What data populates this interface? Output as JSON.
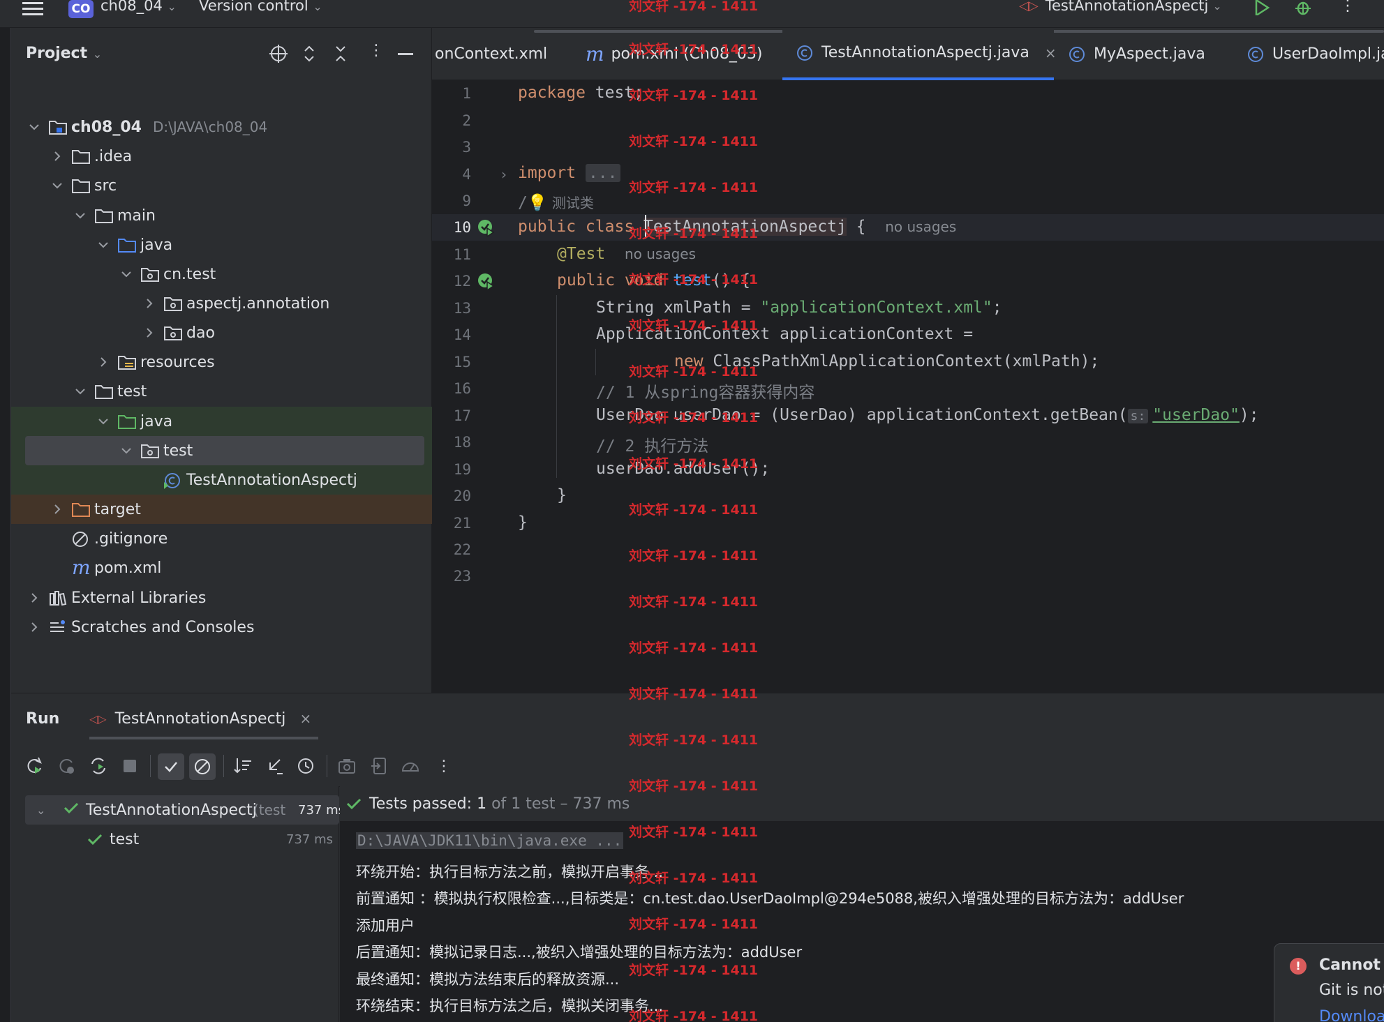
{
  "topbar": {
    "project_badge": "CO",
    "project_name": "ch08_04",
    "vcs_label": "Version control",
    "run_config": "TestAnnotationAspectj"
  },
  "project_panel": {
    "title": "Project",
    "tree": [
      {
        "label": "ch08_04",
        "path": "D:\\JAVA\\ch08_04",
        "depth": 0,
        "icon": "module-folder-icon",
        "expanded": true
      },
      {
        "label": ".idea",
        "depth": 1,
        "icon": "folder-icon",
        "expanded": false
      },
      {
        "label": "src",
        "depth": 1,
        "icon": "folder-icon",
        "expanded": true
      },
      {
        "label": "main",
        "depth": 2,
        "icon": "folder-icon",
        "expanded": true
      },
      {
        "label": "java",
        "depth": 3,
        "icon": "source-folder-icon",
        "expanded": true
      },
      {
        "label": "cn.test",
        "depth": 4,
        "icon": "package-icon",
        "expanded": true
      },
      {
        "label": "aspectj.annotation",
        "depth": 5,
        "icon": "package-icon",
        "expanded": false
      },
      {
        "label": "dao",
        "depth": 5,
        "icon": "package-icon",
        "expanded": false
      },
      {
        "label": "resources",
        "depth": 3,
        "icon": "resources-folder-icon",
        "expanded": false
      },
      {
        "label": "test",
        "depth": 2,
        "icon": "folder-icon",
        "expanded": true
      },
      {
        "label": "java",
        "depth": 3,
        "icon": "test-folder-icon",
        "expanded": true
      },
      {
        "label": "test",
        "depth": 4,
        "icon": "package-icon",
        "expanded": true
      },
      {
        "label": "TestAnnotationAspectj",
        "depth": 5,
        "icon": "class-icon"
      },
      {
        "label": "target",
        "depth": 1,
        "icon": "excluded-folder-icon",
        "expanded": false
      },
      {
        "label": ".gitignore",
        "depth": 1,
        "icon": "ignore-file-icon"
      },
      {
        "label": "pom.xml",
        "depth": 1,
        "icon": "maven-icon"
      },
      {
        "label": "External Libraries",
        "depth": 0,
        "icon": "libraries-icon",
        "expanded": false
      },
      {
        "label": "Scratches and Consoles",
        "depth": 0,
        "icon": "scratches-icon",
        "expanded": false
      }
    ]
  },
  "editor": {
    "tabs": [
      {
        "label": "onContext.xml",
        "icon": ""
      },
      {
        "label": "pom.xml (Ch08_03)",
        "icon": "maven-icon"
      },
      {
        "label": "TestAnnotationAspectj.java",
        "icon": "class-icon",
        "active": true
      },
      {
        "label": "MyAspect.java",
        "icon": "class-icon"
      },
      {
        "label": "UserDaoImpl.jav",
        "icon": "class-icon"
      }
    ],
    "line_numbers": [
      "1",
      "2",
      "3",
      "4",
      "9",
      "10",
      "11",
      "12",
      "13",
      "14",
      "15",
      "16",
      "17",
      "18",
      "19",
      "20",
      "21",
      "22",
      "23"
    ],
    "code": {
      "l1_kw": "package",
      "l1_rest": " test;",
      "l4_kw": "import",
      "l4_fold": "...",
      "l9_cmt": "/",
      "l9_cmt2": " 测试类",
      "l10_kw": "public class ",
      "l10_name": "TestAnnotationAspectj",
      "l10_rest": " {",
      "l10_hint": "no usages",
      "l11_ann": "@Test",
      "l11_hint": "no usages",
      "l12_kw": "public void ",
      "l12_fn": "test",
      "l12_rest": "() {",
      "l13_a": "String xmlPath = ",
      "l13_str": "\"applicationContext.xml\"",
      "l13_b": ";",
      "l14": "ApplicationContext applicationContext =",
      "l15_kw": "new ",
      "l15_rest": "ClassPathXmlApplicationContext(xmlPath);",
      "l16": "// 1 从spring容器获得内容",
      "l17_a": "UserDao userDao = (UserDao) applicationContext.getBean(",
      "l17_hint": "s:",
      "l17_str": "\"userDao\"",
      "l17_b": ");",
      "l18": "// 2 执行方法",
      "l19": "userDao.addUser();",
      "l20": "}",
      "l21": "}"
    }
  },
  "watermark": "刘文轩 -174 - 1411",
  "run_panel": {
    "title": "Run",
    "tab_label": "TestAnnotationAspectj",
    "tests": [
      {
        "name": "TestAnnotationAspectj",
        "suffix": "(test",
        "time": "737 ms"
      },
      {
        "name": "test",
        "time": "737 ms"
      }
    ],
    "status_prefix": "Tests passed:",
    "status_count": "1",
    "status_rest": "of 1 test – 737 ms",
    "console": [
      "D:\\JAVA\\JDK11\\bin\\java.exe ...",
      "环绕开始：执行目标方法之前，模拟开启事务...",
      "前置通知 ：模拟执行权限检查...,目标类是：cn.test.dao.UserDaoImpl@294e5088,被织入增强处理的目标方法为：addUser",
      "添加用户",
      "后置通知：模拟记录日志...,被织入增强处理的目标方法为：addUser",
      "最终通知：模拟方法结束后的释放资源...",
      "环绕结束：执行目标方法之后，模拟关闭事务..."
    ]
  },
  "notification": {
    "title": "Cannot R",
    "body": "Git is not",
    "link": "Downloa"
  }
}
